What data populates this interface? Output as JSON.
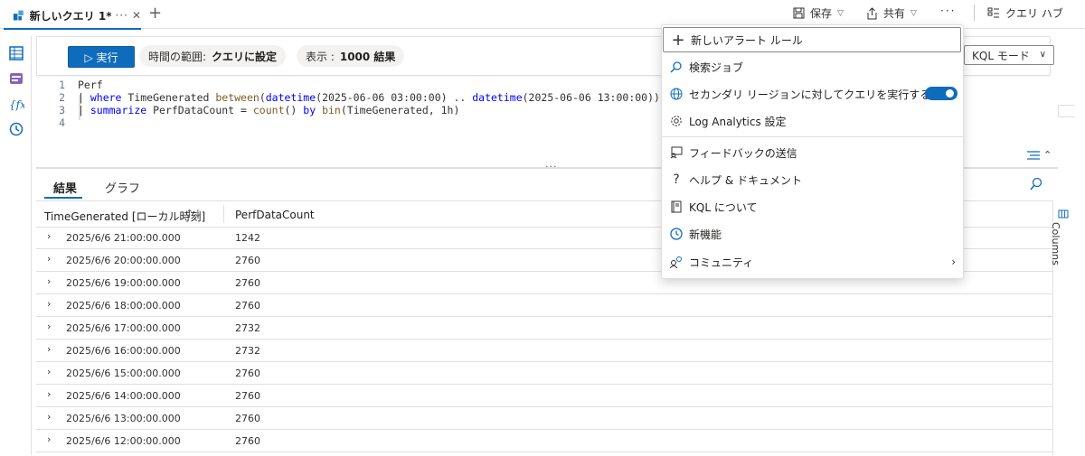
{
  "tab": {
    "title": "新しいクエリ 1*",
    "more": "···",
    "close": "✕",
    "add": "+"
  },
  "topbar": {
    "save": "保存",
    "share": "共有",
    "more": "···",
    "query_hub": "クエリ ハブ"
  },
  "toolbar": {
    "run": "▷ 実行",
    "time_range_label": "時間の範囲:",
    "time_range_value": "クエリに設定",
    "display_label": "表示 :",
    "display_value": "1000 結果",
    "mode": "KQL モード"
  },
  "editor": {
    "lines": [
      {
        "num": "1",
        "text": "Perf"
      },
      {
        "num": "2",
        "text": "| where TimeGenerated between(datetime(2025-06-06 03:00:00) .. datetime(2025-06-06 13:00:00))"
      },
      {
        "num": "3",
        "text": "| summarize PerfDataCount = count() by bin(TimeGenerated, 1h)"
      },
      {
        "num": "4",
        "text": ""
      }
    ]
  },
  "results": {
    "tabs": [
      "結果",
      "グラフ"
    ],
    "columns": [
      "TimeGenerated [ローカル時刻]",
      "PerfDataCount"
    ],
    "sort_icon": "↑↓",
    "rows": [
      [
        "2025/6/6 21:00:00.000",
        "1242"
      ],
      [
        "2025/6/6 20:00:00.000",
        "2760"
      ],
      [
        "2025/6/6 19:00:00.000",
        "2760"
      ],
      [
        "2025/6/6 18:00:00.000",
        "2760"
      ],
      [
        "2025/6/6 17:00:00.000",
        "2732"
      ],
      [
        "2025/6/6 16:00:00.000",
        "2732"
      ],
      [
        "2025/6/6 15:00:00.000",
        "2760"
      ],
      [
        "2025/6/6 14:00:00.000",
        "2760"
      ],
      [
        "2025/6/6 13:00:00.000",
        "2760"
      ],
      [
        "2025/6/6 12:00:00.000",
        "2760"
      ]
    ],
    "columns_panel": "Columns"
  },
  "menu": {
    "items": [
      {
        "label": "新しいアラート ルール",
        "icon": "plus-icon"
      },
      {
        "label": "検索ジョブ",
        "icon": "search-job-icon"
      },
      {
        "label": "セカンダリ リージョンに対してクエリを実行する",
        "icon": "globe-icon",
        "toggle": true
      },
      {
        "label": "Log Analytics 設定",
        "icon": "gear-icon"
      },
      {
        "label": "フィードバックの送信",
        "icon": "feedback-icon"
      },
      {
        "label": "ヘルプ & ドキュメント",
        "icon": "help-icon"
      },
      {
        "label": "KQL について",
        "icon": "book-icon"
      },
      {
        "label": "新機能",
        "icon": "clock-icon"
      },
      {
        "label": "コミュニティ",
        "icon": "community-icon"
      }
    ]
  },
  "colors": {
    "accent": "#0f6cbd"
  }
}
